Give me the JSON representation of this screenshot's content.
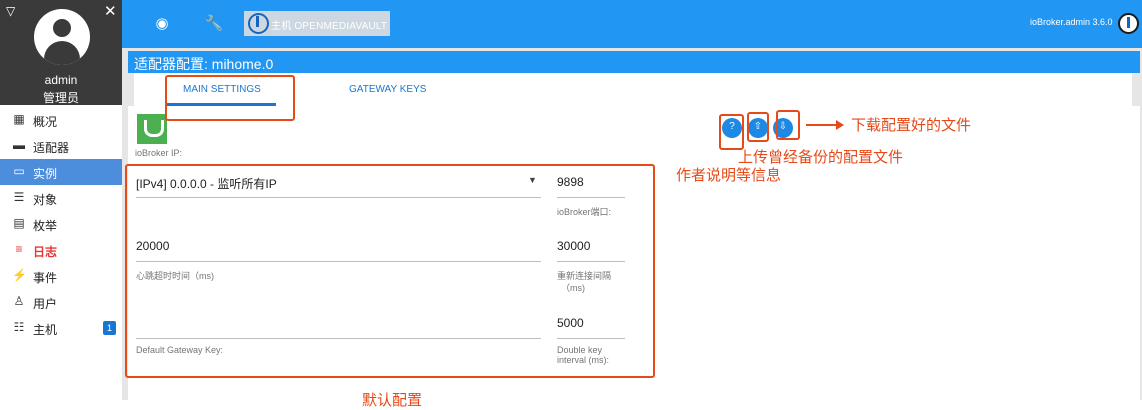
{
  "sidebar": {
    "user_name": "admin",
    "user_role": "管理员",
    "items": [
      {
        "icon": "grid-icon",
        "glyph": "▦",
        "label": "概况"
      },
      {
        "icon": "store-icon",
        "glyph": "▬",
        "label": "适配器"
      },
      {
        "icon": "card-icon",
        "glyph": "▭",
        "label": "实例"
      },
      {
        "icon": "list-icon",
        "glyph": "☰",
        "label": "对象"
      },
      {
        "icon": "enum-icon",
        "glyph": "▤",
        "label": "枚举"
      },
      {
        "icon": "log-icon",
        "glyph": "≡",
        "label": "日志"
      },
      {
        "icon": "lightning-icon",
        "glyph": "⚡",
        "label": "事件"
      },
      {
        "icon": "user-icon",
        "glyph": "♙",
        "label": "用户"
      },
      {
        "icon": "host-list-icon",
        "glyph": "☷",
        "label": "主机",
        "badge": "1"
      }
    ]
  },
  "topbar": {
    "host_label": "主机 OPENMEDIAVAULT",
    "admin_version": "ioBroker.admin 3.6.0"
  },
  "panel": {
    "title": "适配器配置: mihome.0",
    "tabs": [
      "MAIN SETTINGS",
      "GATEWAY KEYS"
    ]
  },
  "form": {
    "iobroker_ip_label": "ioBroker IP:",
    "bind_value": "[IPv4] 0.0.0.0 - 监听所有IP",
    "port_value": "9898",
    "port_label": "ioBroker端口:",
    "heartbeat_value": "20000",
    "heartbeat_label": "心跳超时时间（ms)",
    "reconnect_value": "30000",
    "reconnect_label_1": "重新连接间隔",
    "reconnect_label_2": "（ms)",
    "double_key_value": "5000",
    "double_key_label_1": "Double key",
    "double_key_label_2": "interval (ms):",
    "default_key_label": "Default Gateway Key:"
  },
  "annotations": {
    "download": "下载配置好的文件",
    "upload": "上传曾经备份的配置文件",
    "info": "作者说明等信息",
    "defaults": "默认配置"
  },
  "colors": {
    "topbar": "#2196f3",
    "sidebar_active": "#4c8ddc",
    "annotation": "#e64a19"
  }
}
